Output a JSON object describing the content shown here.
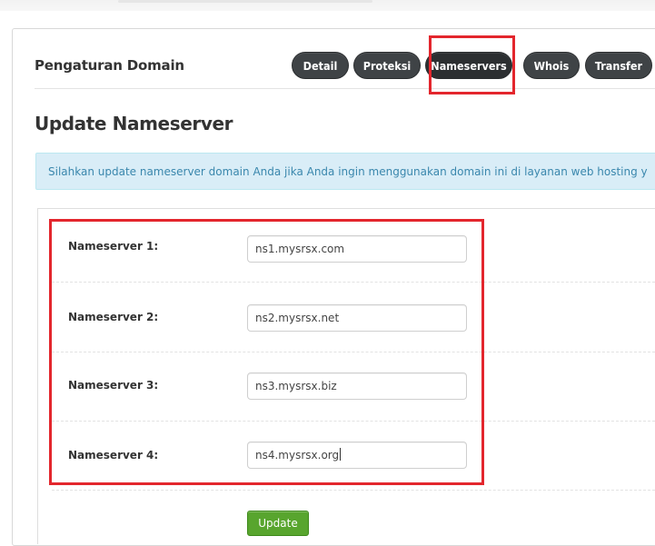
{
  "panel": {
    "title": "Pengaturan Domain",
    "tabs": [
      {
        "label": "Detail"
      },
      {
        "label": "Proteksi"
      },
      {
        "label": "Nameservers",
        "active": true
      },
      {
        "label": "Whois"
      },
      {
        "label": "Transfer"
      }
    ]
  },
  "section": {
    "title": "Update Nameserver",
    "info": "Silahkan update nameserver domain Anda jika Anda ingin menggunakan domain ini di layanan web hosting y"
  },
  "form": {
    "rows": [
      {
        "label": "Nameserver 1:",
        "value": "ns1.mysrsx.com"
      },
      {
        "label": "Nameserver 2:",
        "value": "ns2.mysrsx.net"
      },
      {
        "label": "Nameserver 3:",
        "value": "ns3.mysrsx.biz"
      },
      {
        "label": "Nameserver 4:",
        "value": "ns4.mysrsx.org"
      }
    ],
    "submit_label": "Update"
  },
  "colors": {
    "tab_bg": "#3f4346",
    "highlight": "#e3262d",
    "info_bg": "#d9edf7",
    "info_text": "#3a87ad",
    "button_green": "#58a52e"
  }
}
